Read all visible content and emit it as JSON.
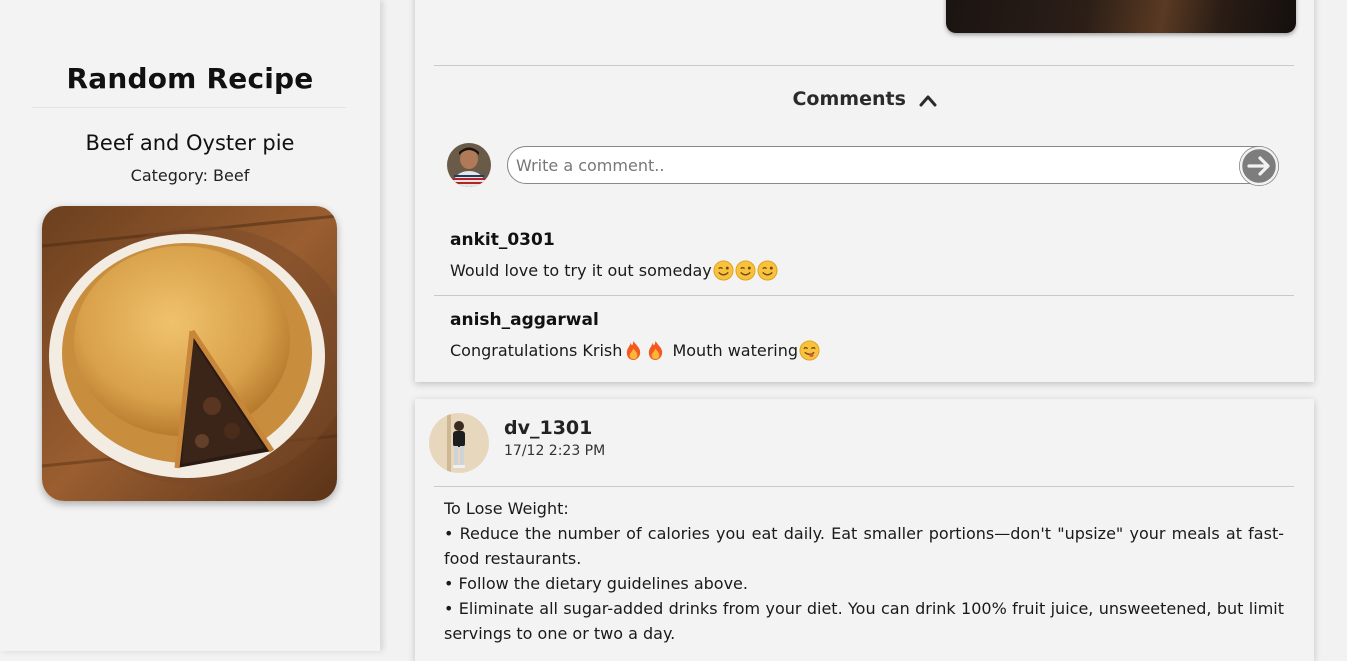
{
  "random_recipe": {
    "heading": "Random Recipe",
    "meal_name": "Beef and Oyster pie",
    "category_label": "Category:",
    "category": "Beef",
    "image_icon": "pie-photo"
  },
  "post1": {
    "comments_label": "Comments",
    "comment_input_placeholder": "Write a comment..",
    "comments": [
      {
        "user": "ankit_0301",
        "text": "Would love to try it out someday",
        "emojis": [
          "wink",
          "wink",
          "wink"
        ]
      },
      {
        "user": "anish_aggarwal",
        "text_before": "Congratulations Krish",
        "emojis_mid": [
          "fire",
          "fire"
        ],
        "text_after": " Mouth watering",
        "emojis_end": [
          "yum"
        ]
      }
    ]
  },
  "post2": {
    "user": "dv_1301",
    "timestamp": "17/12 2:23 PM",
    "lines": [
      "To Lose Weight:",
      "• Reduce the number of calories you eat daily. Eat smaller portions—don't \"upsize\" your meals at fast-food restaurants.",
      "• Follow the dietary guidelines above.",
      "• Eliminate all sugar-added drinks from your diet. You can drink 100% fruit juice, unsweetened, but limit servings to one or two a day."
    ]
  },
  "colors": {
    "background": "#f2f2f2",
    "card": "#f3f3f3",
    "send_button": "#7d7d7d"
  }
}
